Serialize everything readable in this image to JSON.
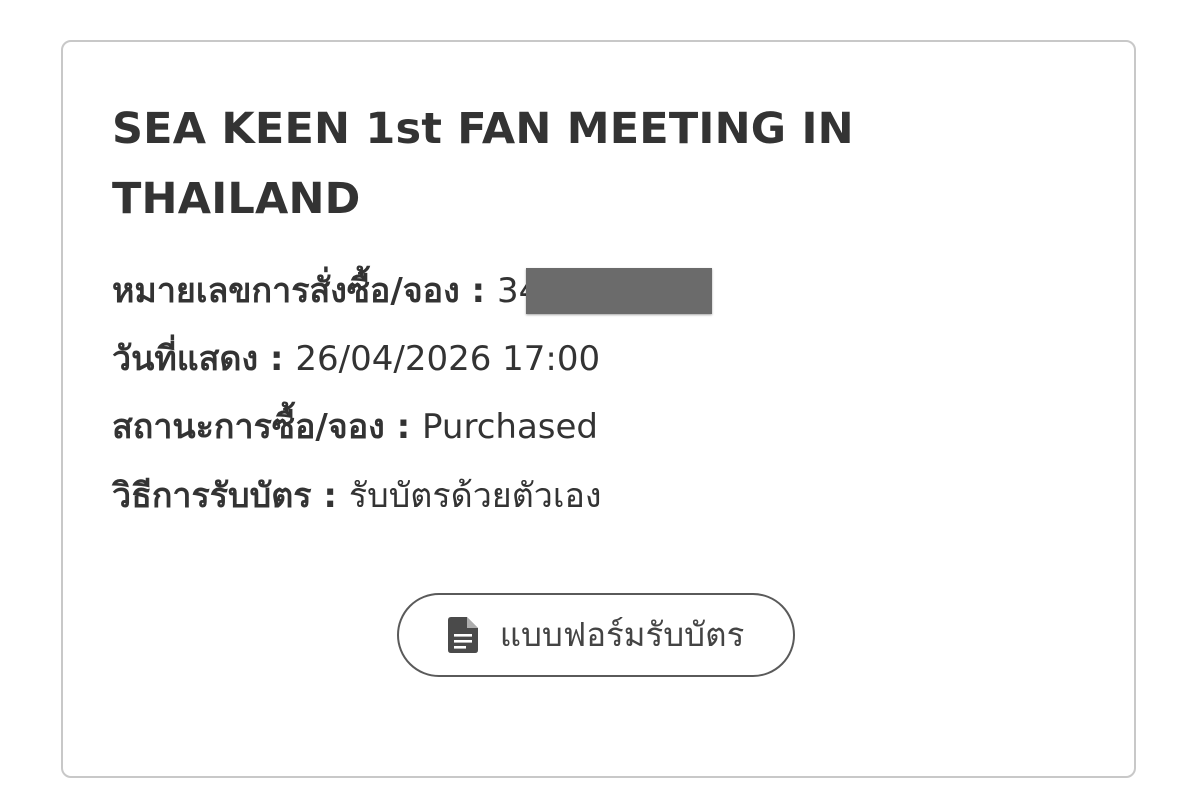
{
  "event": {
    "title": "SEA KEEN 1st FAN MEETING IN THAILAND"
  },
  "details": {
    "order_number": {
      "label": "หมายเลขการสั่งซื้อ/จอง",
      "separator": " : ",
      "value": "34",
      "redacted": true
    },
    "show_date": {
      "label": "วันที่แสดง",
      "separator": " : ",
      "value": "26/04/2026 17:00"
    },
    "purchase_status": {
      "label": "สถานะการซื้อ/จอง",
      "separator": " : ",
      "value": "Purchased"
    },
    "ticket_method": {
      "label": "วิธีการรับบัตร",
      "separator": " : ",
      "value": "รับบัตรด้วยตัวเอง"
    }
  },
  "actions": {
    "ticket_form_label": "แบบฟอร์มรับบัตร",
    "ticket_form_icon": "document-icon"
  },
  "colors": {
    "text": "#333333",
    "card_border": "#c8c8c8",
    "button_border": "#5a5a5a",
    "redaction": "#6b6b6b"
  }
}
